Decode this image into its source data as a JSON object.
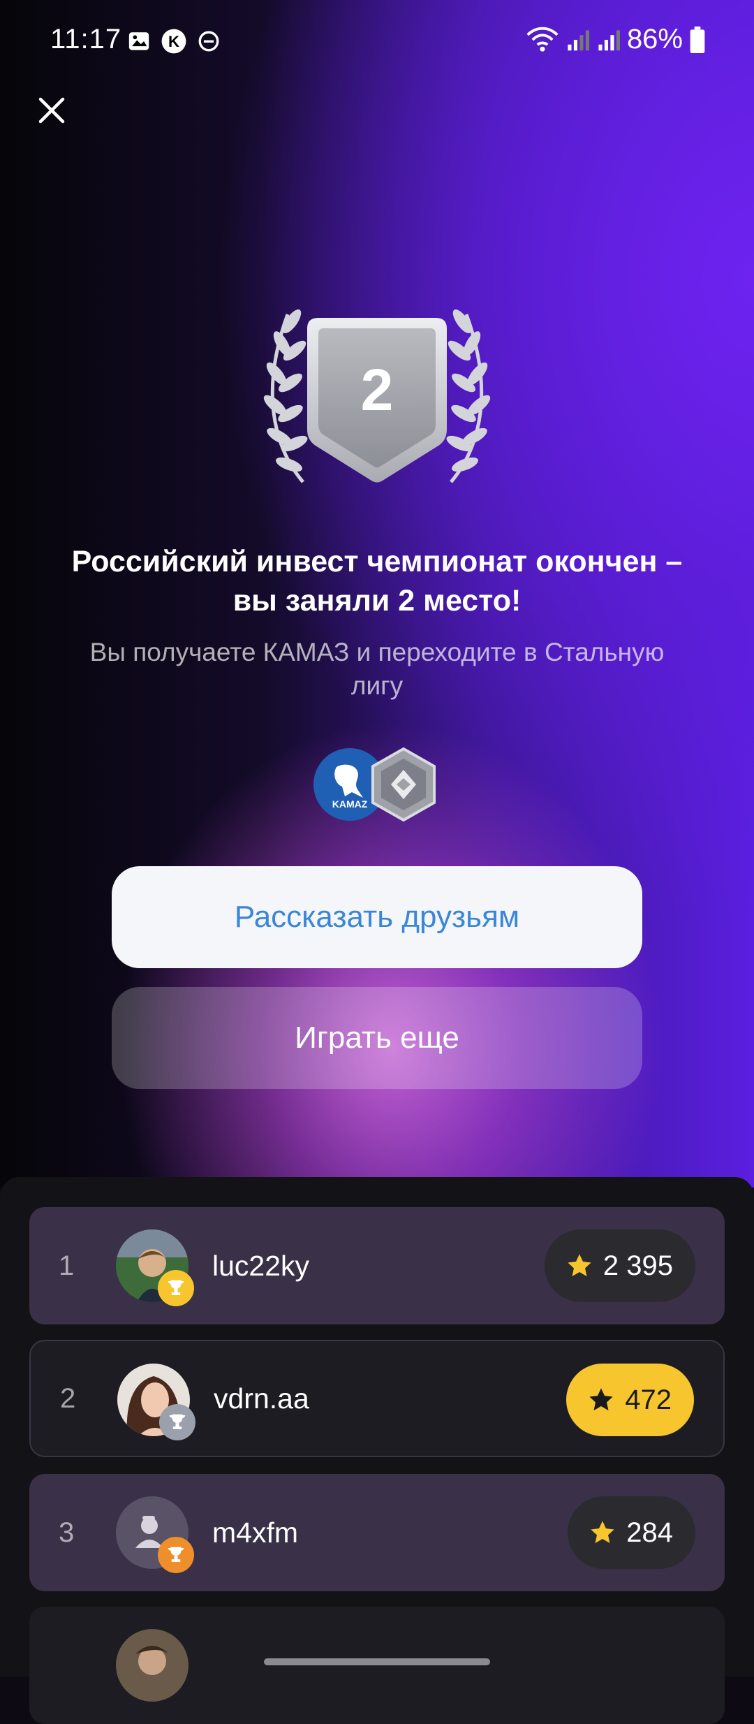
{
  "status": {
    "time": "11:17",
    "battery": "86%"
  },
  "badge": {
    "place": "2"
  },
  "result": {
    "title": "Российский инвест чемпионат окончен – вы заняли 2 место!",
    "subtitle": "Вы получаете КАМАЗ и переходите в Стальную лигу"
  },
  "rewards": {
    "icons": [
      "kamaz-logo-icon",
      "steel-league-icon"
    ]
  },
  "actions": {
    "share": "Рассказать друзьям",
    "play_again": "Играть еще"
  },
  "leaderboard": [
    {
      "rank": "1",
      "name": "luc22ky",
      "score": "2 395",
      "trophy": "gold"
    },
    {
      "rank": "2",
      "name": "vdrn.aa",
      "score": "472",
      "trophy": "silver"
    },
    {
      "rank": "3",
      "name": "m4xfm",
      "score": "284",
      "trophy": "bronze"
    }
  ],
  "colors": {
    "accent_gold": "#f7c62f",
    "share_text": "#3a86d8",
    "background_purple": "#5a1fe0"
  }
}
